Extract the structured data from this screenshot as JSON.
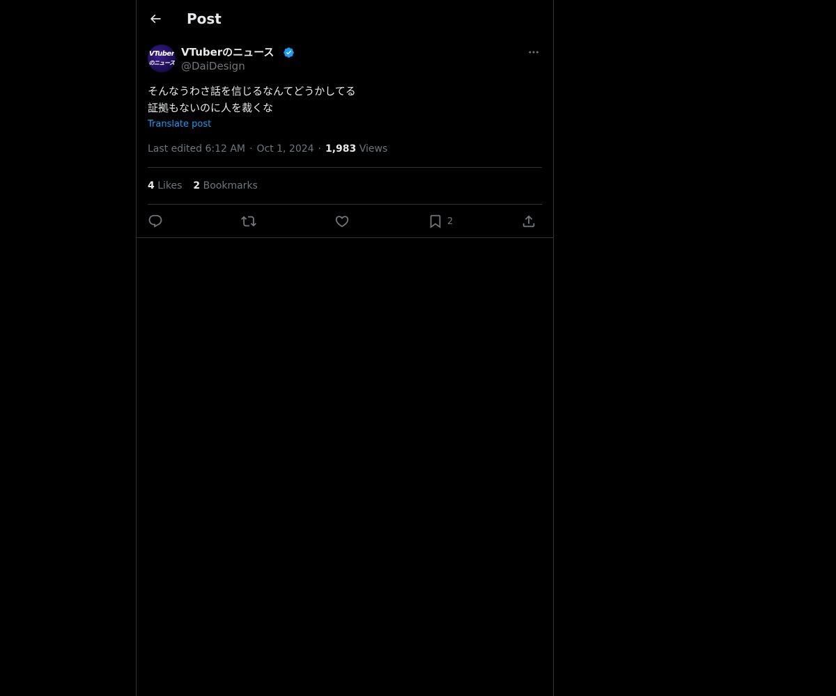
{
  "header": {
    "title": "Post",
    "back_icon": "arrow-left-icon"
  },
  "author": {
    "display_name": "VTuberのニュース",
    "handle": "@DaiDesign",
    "verified": true,
    "avatar_line1": "VTuber",
    "avatar_line2": "のニュース",
    "more_icon": "more-horizontal-icon"
  },
  "post": {
    "text_lines": [
      "そんなうわさ話を信じるなんてどうかしてる",
      "証拠もないのに人を裁くな"
    ],
    "translate_label": "Translate post",
    "edited_label": "Last edited 6:12 AM",
    "date": "Oct 1, 2024",
    "views_count": "1,983",
    "views_label": "Views"
  },
  "stats": {
    "likes_count": "4",
    "likes_label": "Likes",
    "bookmarks_count": "2",
    "bookmarks_label": "Bookmarks"
  },
  "actions": {
    "reply_icon": "reply-icon",
    "repost_icon": "repost-icon",
    "like_icon": "heart-icon",
    "bookmark_icon": "bookmark-icon",
    "bookmark_count": "2",
    "share_icon": "share-icon"
  },
  "colors": {
    "background": "#000000",
    "text_primary": "#e7e9ea",
    "text_secondary": "#71767b",
    "accent": "#1d9bf0",
    "border": "#2f3336"
  }
}
